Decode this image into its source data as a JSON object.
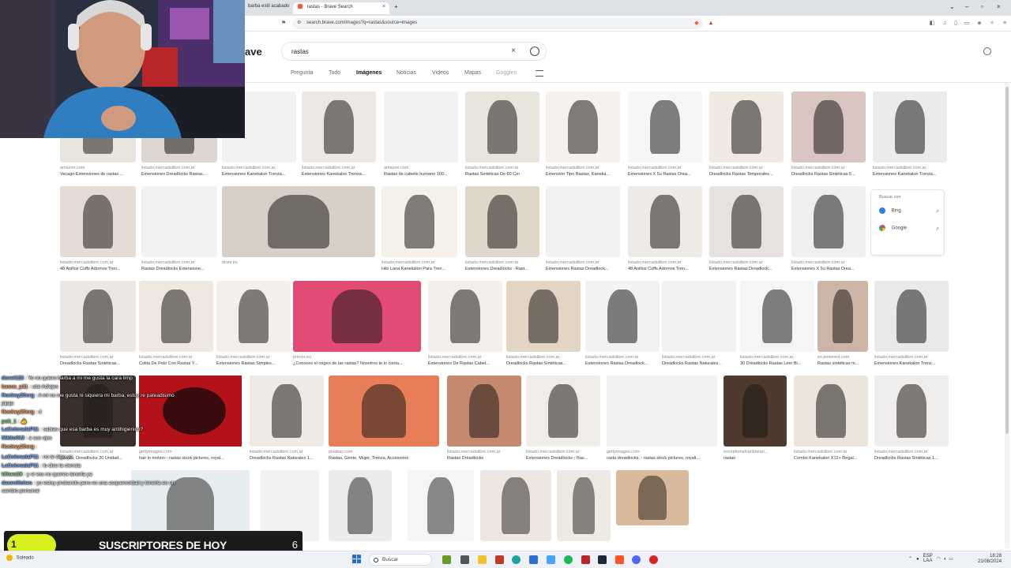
{
  "browser": {
    "tabs": [
      {
        "label": "barba estil acabado"
      },
      {
        "label": "rastas - Brave Search",
        "active": true
      }
    ],
    "url": "search.brave.com/images?q=rastas&source=images"
  },
  "search": {
    "brand": "ave",
    "query": "rastas",
    "tabs": [
      "Pregunta",
      "Todo",
      "Imágenes",
      "Noticias",
      "Videos",
      "Mapas",
      "Goggles"
    ],
    "active_tab": "Imágenes"
  },
  "results": [
    {
      "src": "amazon.com",
      "title": "Vecago Extensiones de rastas ..."
    },
    {
      "src": "listado.mercadolibre.com.ar",
      "title": "Extensiones Dreadlocks Rastas..."
    },
    {
      "src": "listado.mercadolibre.com.ar",
      "title": "Extensiones Kanekalon Trenza..."
    },
    {
      "src": "listado.mercadolibre.com.ar",
      "title": "Extensiones Kanekalon Trenza..."
    },
    {
      "src": "amazon.com",
      "title": "Rastas de cabello humano 100..."
    },
    {
      "src": "listado.mercadolibre.com.ar",
      "title": "Rastas Sintéticas De 60 Cm"
    },
    {
      "src": "listado.mercadolibre.com.ar",
      "title": "Extensión Tipo Rastas, Kaneka..."
    },
    {
      "src": "listado.mercadolibre.com.ar",
      "title": "Extensiones X 5u Rastas Drea..."
    },
    {
      "src": "listado.mercadolibre.com.ar",
      "title": "Dreadlocks Rastas Temporales..."
    },
    {
      "src": "listado.mercadolibre.com.ar",
      "title": "Dreadlocks Rastas Sintéticas 5..."
    },
    {
      "src": "listado.mercadolibre.com.ar",
      "title": "Extensiones Kanekalon Trenza..."
    },
    {
      "src": "listado.mercadolibre.com.ar",
      "title": "48 Anillos Cuffs Adornos Tren..."
    },
    {
      "src": "listado.mercadolibre.com.ar",
      "title": "Rastas Dreadlocks Extensione..."
    },
    {
      "src": "druni.es",
      "title": ""
    },
    {
      "src": "listado.mercadolibre.com.ar",
      "title": "Hilo Lana Kanekalon Para Tren..."
    },
    {
      "src": "listado.mercadolibre.com.ar",
      "title": "Extensiones Dreadlocks - Rast..."
    },
    {
      "src": "listado.mercadolibre.com.ar",
      "title": "Extensiones Rastas Dreadlock..."
    },
    {
      "src": "listado.mercadolibre.com.ar",
      "title": "48 Anillos Cuffs Adornos Tren..."
    },
    {
      "src": "listado.mercadolibre.com.ar",
      "title": "Extensiones Rastas Dreadlock..."
    },
    {
      "src": "listado.mercadolibre.com.ar",
      "title": "Extensiones X 5u Rastas Drea..."
    },
    {
      "src": "listado.mercadolibre.com.ar",
      "title": "Dreadlocks Rastas Sintéticas..."
    },
    {
      "src": "listado.mercadolibre.com.ar",
      "title": "Colita De Pelo Con Rastas Y..."
    },
    {
      "src": "listado.mercadolibre.com.ar",
      "title": "Extensiones Rastas Simples..."
    },
    {
      "src": "primor.eu",
      "title": "¿Conoces el origen de las rastas? Nosotros te lo conta..."
    },
    {
      "src": "listado.mercadolibre.com.ar",
      "title": "Extensiones De Rastas Cabel..."
    },
    {
      "src": "listado.mercadolibre.com.ar",
      "title": "Dreadlocks Rastas Sintéticas..."
    },
    {
      "src": "listado.mercadolibre.com.ar",
      "title": "Extensiones Rastas Dreadlock..."
    },
    {
      "src": "listado.mercadolibre.com.ar",
      "title": "Dreadlocks Rastas Naturales..."
    },
    {
      "src": "listado.mercadolibre.com.ar",
      "title": "30 Dreadlocks Rastas Leer Bi..."
    },
    {
      "src": "es.pinterest.com",
      "title": "Rastas sintéticas m..."
    },
    {
      "src": "listado.mercadolibre.com.ar",
      "title": "Extensiones Kanekalon Trenz..."
    },
    {
      "src": "listado.mercadolibre.com.ar",
      "title": "Rastas, Dreadlocks 20 Unidad..."
    },
    {
      "src": "gettyimages.com",
      "title": "hair in motion - rastas stock pictures, royal..."
    },
    {
      "src": "listado.mercadolibre.com.ar",
      "title": "Dreadlocks Rastas Naturales 1..."
    },
    {
      "src": "pixabay.com",
      "title": "Rastas, Gente, Mujer, Trenza, Accesorios"
    },
    {
      "src": "listado.mercadolibre.com.ar",
      "title": "Rastas Dreadlocks"
    },
    {
      "src": "listado.mercadolibre.com.ar",
      "title": "Extensiones Dreadlocks - Ras..."
    },
    {
      "src": "gettyimages.com",
      "title": "rasta dreadlocks. - rastas stock pictures, royalt..."
    },
    {
      "src": "exceptionalcaribbean...",
      "title": "rastas"
    },
    {
      "src": "listado.mercadolibre.com.ar",
      "title": "Combo Kanekalon X12+ Regal..."
    },
    {
      "src": "listado.mercadolibre.com.ar",
      "title": "Dreadlocks Rastas Sintéticas 1..."
    }
  ],
  "searchwith": {
    "header": "Buscar con",
    "items": [
      "Bing",
      "Google"
    ]
  },
  "chat": [
    {
      "user": "duvel128",
      "msg": ": Yo no quiero barba a mi me gusta la cara limp"
    },
    {
      "user": "basus_p11",
      "msg": ": ulai Adlejes"
    },
    {
      "user": "Rochey20org",
      "msg": ": A mi no me gusta ni siquiera mi barba, estoy re pateadisimo"
    },
    {
      "user": "",
      "msg": "jajaja"
    },
    {
      "user": "Rochey20org",
      "msg": ": d"
    },
    {
      "user": "poli_1",
      "msg": ": 👍"
    },
    {
      "user": "LaColoradaP11",
      "msg": ": sabias que esa barba es muy antihigienico?"
    },
    {
      "user": "Nikito013",
      "msg": ": a sus ojos"
    },
    {
      "user": "Rochey20org",
      "msg": ":"
    },
    {
      "user": "LaColoradaP11",
      "msg": ": no te digo yo"
    },
    {
      "user": "LaColoradaP11",
      "msg": ": lo dice la ciencia"
    },
    {
      "user": "Ulises16",
      "msg": ": y si vos no queres tenerla ya"
    },
    {
      "user": "daveviilches",
      "msg": ": yo estoy probando pero es una asquerosidad y tenerla es un"
    },
    {
      "user": "",
      "msg": "cambio personal"
    }
  ],
  "subs_widget": {
    "count_left": "1",
    "label": "SUSCRIPTORES DE HOY",
    "count": "6"
  },
  "taskbar": {
    "weather": "Soleado",
    "search_label": "Buscar",
    "lang_top": "ESP",
    "lang_bottom": "LAA",
    "time": "18:28",
    "date": "21/08/2024"
  },
  "colors": {
    "accent_subs": "#d7f01e",
    "brave_alert": "#fb542b"
  }
}
